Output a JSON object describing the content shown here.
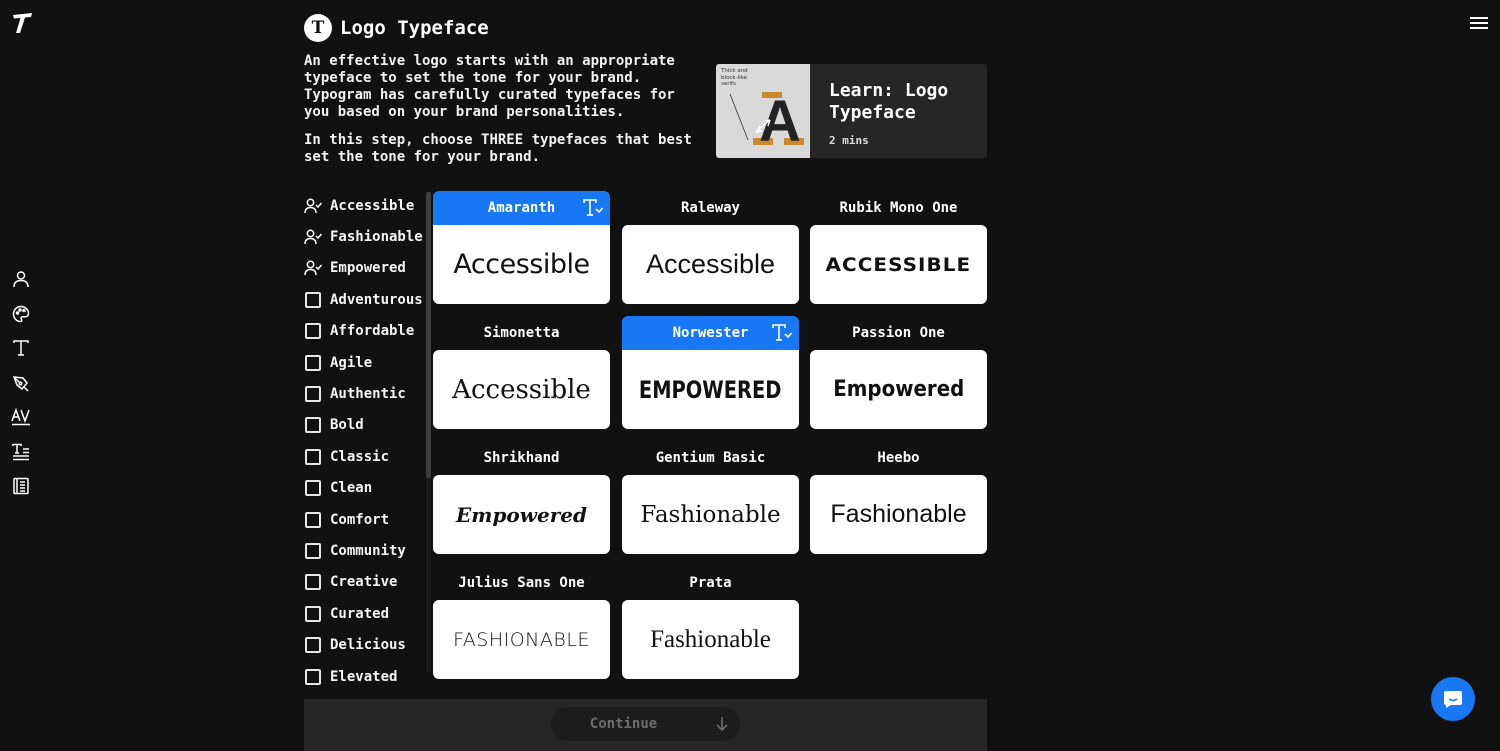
{
  "header": {
    "badge": "T",
    "title": "Logo Typeface"
  },
  "intro": {
    "paragraph1": "An effective logo starts with an appropriate typeface to set the tone for your brand. Typogram has carefully curated typefaces for you based on your brand personalities.",
    "paragraph2_pre": "In this step, choose ",
    "paragraph2_em": "THREE",
    "paragraph2_post": " typefaces that best set the tone for your brand."
  },
  "learn": {
    "title": "Learn: Logo Typeface",
    "duration": "2 mins",
    "thumb_note": "Thick and block-like serifs",
    "thumb_letter": "A"
  },
  "rail": {
    "items": [
      {
        "icon": "user-icon"
      },
      {
        "icon": "palette-icon"
      },
      {
        "icon": "typeface-icon"
      },
      {
        "icon": "pen-nib-icon"
      },
      {
        "icon": "kerning-icon"
      },
      {
        "icon": "text-align-icon"
      },
      {
        "icon": "guide-book-icon"
      }
    ]
  },
  "personalities": [
    {
      "label": "Accessible",
      "selected": true
    },
    {
      "label": "Fashionable",
      "selected": true
    },
    {
      "label": "Empowered",
      "selected": true
    },
    {
      "label": "Adventurous",
      "selected": false
    },
    {
      "label": "Affordable",
      "selected": false
    },
    {
      "label": "Agile",
      "selected": false
    },
    {
      "label": "Authentic",
      "selected": false
    },
    {
      "label": "Bold",
      "selected": false
    },
    {
      "label": "Classic",
      "selected": false
    },
    {
      "label": "Clean",
      "selected": false
    },
    {
      "label": "Comfort",
      "selected": false
    },
    {
      "label": "Community",
      "selected": false
    },
    {
      "label": "Creative",
      "selected": false
    },
    {
      "label": "Curated",
      "selected": false
    },
    {
      "label": "Delicious",
      "selected": false
    },
    {
      "label": "Elevated",
      "selected": false
    }
  ],
  "typefaces": [
    {
      "name": "Amaranth",
      "sample": "Accessible",
      "selected": true
    },
    {
      "name": "Raleway",
      "sample": "Accessible",
      "selected": false
    },
    {
      "name": "Rubik Mono One",
      "sample": "ACCESSIBLE",
      "selected": false
    },
    {
      "name": "Simonetta",
      "sample": "Accessible",
      "selected": false
    },
    {
      "name": "Norwester",
      "sample": "EMPOWERED",
      "selected": true
    },
    {
      "name": "Passion One",
      "sample": "Empowered",
      "selected": false
    },
    {
      "name": "Shrikhand",
      "sample": "Empowered",
      "selected": false
    },
    {
      "name": "Gentium Basic",
      "sample": "Fashionable",
      "selected": false
    },
    {
      "name": "Heebo",
      "sample": "Fashionable",
      "selected": false
    },
    {
      "name": "Julius Sans One",
      "sample": "FASHIONABLE",
      "selected": false
    },
    {
      "name": "Prata",
      "sample": "Fashionable",
      "selected": false
    }
  ],
  "footer": {
    "continue_label": "Continue"
  },
  "colors": {
    "accent": "#1877f2",
    "background": "#111111",
    "panel": "#262626"
  }
}
